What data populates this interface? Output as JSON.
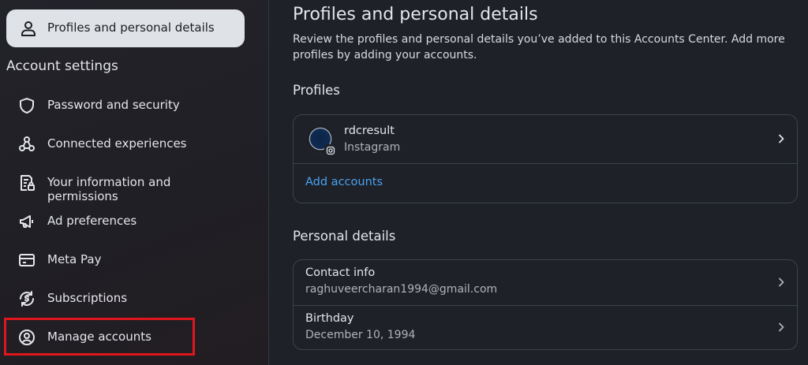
{
  "sidebar": {
    "active_item": {
      "label": "Profiles and personal details",
      "icon": "person-icon"
    },
    "section_title": "Account settings",
    "items": [
      {
        "label": "Password and security",
        "icon": "shield-icon"
      },
      {
        "label": "Connected experiences",
        "icon": "connected-nodes-icon"
      },
      {
        "label": "Your information and permissions",
        "icon": "document-lock-icon"
      },
      {
        "label": "Ad preferences",
        "icon": "megaphone-icon"
      },
      {
        "label": "Meta Pay",
        "icon": "credit-card-icon"
      },
      {
        "label": "Subscriptions",
        "icon": "subscription-dollar-icon"
      },
      {
        "label": "Manage accounts",
        "icon": "person-circle-icon"
      }
    ],
    "highlight_color": "#e0161d"
  },
  "main": {
    "title": "Profiles and personal details",
    "description": "Review the profiles and personal details you’ve added to this Accounts Center. Add more profiles by adding your accounts.",
    "profiles_heading": "Profiles",
    "profile": {
      "username": "rdcresult",
      "platform": "Instagram"
    },
    "add_accounts_label": "Add accounts",
    "personal_heading": "Personal details",
    "contact": {
      "label": "Contact info",
      "value": "raghuveercharan1994@gmail.com"
    },
    "birthday": {
      "label": "Birthday",
      "value": "December 10, 1994"
    }
  },
  "colors": {
    "link": "#4aa3f0",
    "active_bg": "#dfe3e8",
    "background": "#1e2128"
  }
}
